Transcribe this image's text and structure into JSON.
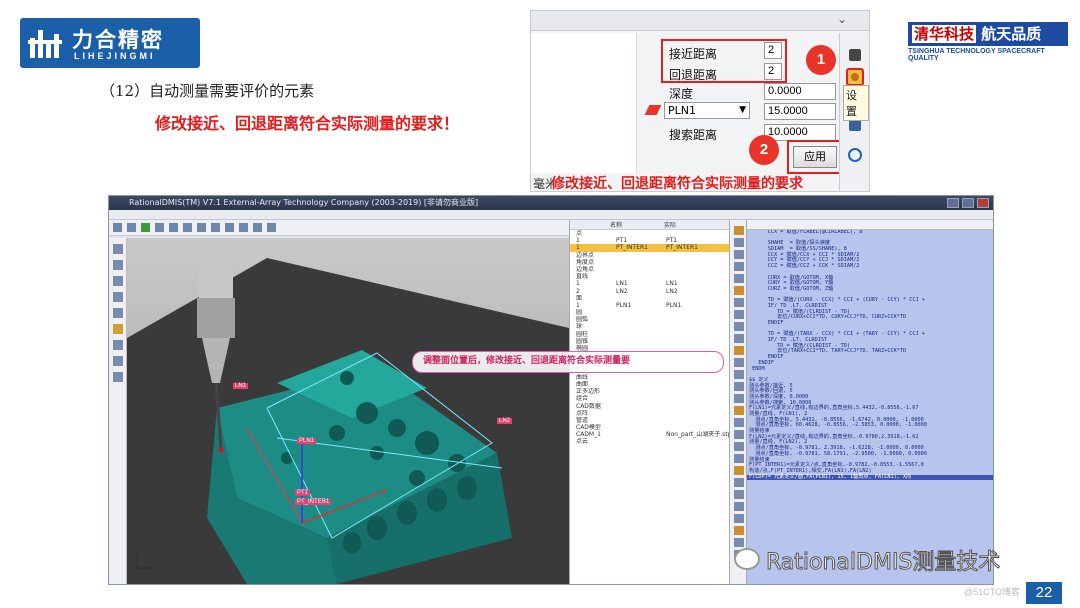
{
  "logo": {
    "cn": "力合精密",
    "en": "LIHEJINGMI"
  },
  "brand": {
    "cn_left": "清华科技",
    "cn_right": "航天品质",
    "en": "TSINGHUA TECHNOLOGY SPACECRAFT QUALITY"
  },
  "step_title": "（12）自动测量需要评价的元素",
  "red_note": "修改接近、回退距离符合实际测量的要求！",
  "settings_panel": {
    "approach_label": "接近距离",
    "approach_value": "2",
    "retract_label": "回退距离",
    "retract_value": "2",
    "depth_label": "深度",
    "depth_value": "0.0000",
    "plane_value": "PLN1",
    "plane_offset": "15.0000",
    "search_label": "搜索距离",
    "search_value": "10.0000",
    "apply_label": "应用",
    "setting_tooltip": "设置",
    "marker_1": "1",
    "marker_2": "2",
    "caption_prefix": "毫米",
    "caption": "修改接近、回退距离符合实际测量的要求"
  },
  "app": {
    "title": "RationalDMIS(TM) V7.1   External-Array Technology Company (2003-2019) [非请勿商业版]",
    "tree_columns": [
      "名称",
      "实际"
    ],
    "tree_rows": [
      {
        "a": "点",
        "b": "",
        "c": ""
      },
      {
        "a": "1",
        "b": "PT1",
        "c": "PT1"
      },
      {
        "a": "1",
        "b": "PT_INTER1",
        "c": "PT_INTER1"
      },
      {
        "a": "边界点",
        "b": "",
        "c": ""
      },
      {
        "a": "角度点",
        "b": "",
        "c": ""
      },
      {
        "a": "边角点",
        "b": "",
        "c": ""
      },
      {
        "a": "直线",
        "b": "",
        "c": ""
      },
      {
        "a": "1",
        "b": "LN1",
        "c": "LN1"
      },
      {
        "a": "2",
        "b": "LN2",
        "c": "LN2"
      },
      {
        "a": "面",
        "b": "",
        "c": ""
      },
      {
        "a": "1",
        "b": "PLN1",
        "c": "PLN1"
      },
      {
        "a": "圆",
        "b": "",
        "c": ""
      },
      {
        "a": "圆弧",
        "b": "",
        "c": ""
      },
      {
        "a": "球",
        "b": "",
        "c": ""
      },
      {
        "a": "圆柱",
        "b": "",
        "c": ""
      },
      {
        "a": "圆锥",
        "b": "",
        "c": ""
      },
      {
        "a": "椭圆",
        "b": "",
        "c": ""
      },
      {
        "a": "键槽",
        "b": "",
        "c": ""
      },
      {
        "a": "平行平面",
        "b": "",
        "c": ""
      },
      {
        "a": "圆环",
        "b": "",
        "c": ""
      },
      {
        "a": "曲线",
        "b": "",
        "c": ""
      },
      {
        "a": "曲面",
        "b": "",
        "c": ""
      },
      {
        "a": "正多边形",
        "b": "",
        "c": ""
      },
      {
        "a": "组合",
        "b": "",
        "c": ""
      },
      {
        "a": "CAD数据",
        "b": "",
        "c": ""
      },
      {
        "a": "点阵",
        "b": "",
        "c": ""
      },
      {
        "a": "管道",
        "b": "",
        "c": ""
      },
      {
        "a": "CAD模型",
        "b": "",
        "c": ""
      },
      {
        "a": "CADM_1",
        "b": "",
        "c": "Non_part_山湖夹子.stp"
      },
      {
        "a": "点云",
        "b": "",
        "c": ""
      }
    ],
    "code_lines": [
      "      CCX = 取值/FLABEL(@CIRLABEL), 8",
      "",
      "      SHAHE  = 取值/探头速度",
      "      SDIAM  = 取值/SS/SHANE), 8",
      "      CCX = 赋值/CCX + CCI * SDIAM/2",
      "      CCY = 赋值/CCY + CCJ * SDIAM/2",
      "      CCZ = 赋值/CCZ + CCK * SDIAM/2",
      "",
      "      CURX = 取值/GOTOM, X轴",
      "      CURY = 取值/GOTOM, Y轴",
      "      CURZ = 取值/GOTOM, Z轴",
      "",
      "      TD = 赋值/(CURX - CCX) * CCI + (CURY - CCY) * CCJ +",
      "      IF/ TD .LT. CLRDIST",
      "         TD = 赋值/(CLRDIST - TD)",
      "         去位/CURX+CCI*TD, CURY+CCJ*TD, CURZ+CCK*TD",
      "      ENDIF",
      "",
      "      TD = 赋值/(TARX - CCX) * CCI + (TARY - CCY) * CCJ +",
      "      IF/ TD .LT. CLRDIST",
      "         TD = 赋值/(CLRDIST - TD)",
      "         去位/TARX+CCI*TD, TARY+CCJ*TD, TARZ+CCK*TD",
      "      ENDIF",
      "   ENDIF",
      " ENDM",
      "",
      "$$ 定义",
      "测头参数/接近, 5",
      "测头参数/回退, 5",
      "测头参数/深度, 0.0000",
      "测头参数/搜索, 10.0000",
      "F(LN1)=元素定义/直线,有边界的,直角坐标,5.4432,-0.8556,-1.67",
      "测量/直线, F(LN1), 2",
      "  测点/直角坐标, 5.4431, -0.8556, -1.6742, 0.0000, -1.0000",
      "  测点/直角坐标, 60.4628, -0.8556, -2.5853, 0.0000, -1.0000",
      "测量结束",
      "F(LN2)=元素定义/直线,有边界的,直角坐标,-0.9780,2.3918,-1.62",
      "测量/直线, F(LN2), 2",
      "  测点/直角坐标, -0.9781, 2.3918, -1.6228, -1.0000, 0.0000",
      "  测点/直角坐标, -0.9781, 58.1791, -2.9500, -1.0000, 0.0000",
      "测量结束",
      "F(PT_INTER1)=元素定义/点,直角坐标,-0.9782,-0.8553,-1.5567,0",
      "构造/点,F(PT_INTER1),相交,FA(LN1),FA(LN2)",
      "F(CDP)= 元素定义/面,FA(PLN1), 15, 1轴再点, FA(LN1), X向"
    ],
    "highlight_line": 43,
    "viewport_labels": [
      "LN1",
      "PLN1",
      "LN2",
      "PT1",
      "PT_INTER1"
    ],
    "viewport_note": "调整面位置后，修改接近、回退距离符合实际测量要"
  },
  "watermark": "RationalDMIS测量技术",
  "blog": "@51CTO博客",
  "page_number": "22",
  "colors": {
    "brand_blue": "#1b5fa8",
    "accent_red": "#e41b1b",
    "part_teal": "#1ea79a"
  }
}
